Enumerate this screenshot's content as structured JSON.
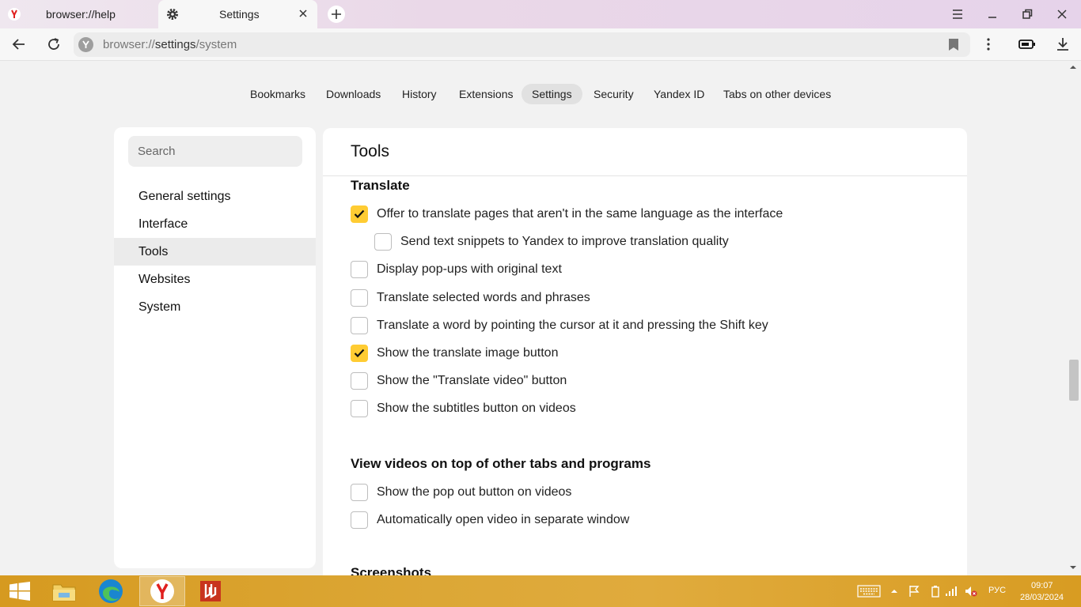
{
  "tabs": [
    {
      "title": "browser://help"
    },
    {
      "title": "Settings"
    }
  ],
  "address": {
    "prefix": "browser://",
    "strong": "settings",
    "suffix": "/system"
  },
  "topnav": [
    "Bookmarks",
    "Downloads",
    "History",
    "Extensions",
    "Settings",
    "Security",
    "Yandex ID",
    "Tabs on other devices"
  ],
  "sidebar": {
    "search_placeholder": "Search",
    "items": [
      "General settings",
      "Interface",
      "Tools",
      "Websites",
      "System"
    ]
  },
  "panel": {
    "title": "Tools",
    "translate": {
      "heading": "Translate",
      "options": [
        {
          "label": "Offer to translate pages that aren't in the same language as the interface",
          "checked": true
        },
        {
          "label": "Send text snippets to Yandex to improve translation quality",
          "checked": false
        },
        {
          "label": "Display pop-ups with original text",
          "checked": false
        },
        {
          "label": "Translate selected words and phrases",
          "checked": false
        },
        {
          "label": "Translate a word by pointing the cursor at it and pressing the Shift key",
          "checked": false
        },
        {
          "label": "Show the translate image button",
          "checked": true
        },
        {
          "label": "Show the \"Translate video\" button",
          "checked": false
        },
        {
          "label": "Show the subtitles button on videos",
          "checked": false
        }
      ]
    },
    "video": {
      "heading": "View videos on top of other tabs and programs",
      "options": [
        {
          "label": "Show the pop out button on videos",
          "checked": false
        },
        {
          "label": "Automatically open video in separate window",
          "checked": false
        }
      ]
    },
    "next_heading": "Screenshots"
  },
  "taskbar": {
    "lang": "РУС",
    "time": "09:07",
    "date": "28/03/2024"
  },
  "colors": {
    "accent": "#ffcc33",
    "taskbar": "#dca736"
  }
}
